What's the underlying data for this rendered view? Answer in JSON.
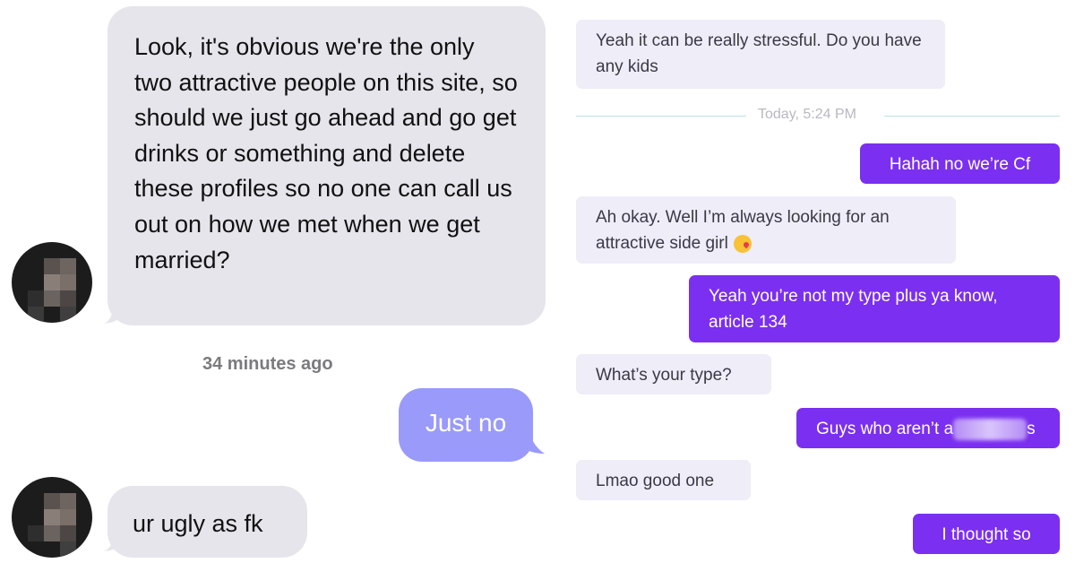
{
  "left_chat": {
    "message_1": "Look, it's obvious we're the only two attractive people on this site, so should we just go ahead and go get drinks or something and delete these profiles so no one can call us out on how we met when we get married?",
    "timestamp": "34 minutes ago",
    "reply_1": "Just no",
    "message_2": "ur ugly as fk"
  },
  "right_chat": {
    "msg_in_1": "Yeah it can be really stressful. Do you have any kids",
    "divider": "Today, 5:24 PM",
    "msg_out_1": "Hahah no we’re Cf",
    "msg_in_2": "Ah okay. Well I’m always looking for an attractive side girl",
    "msg_out_2": "Yeah you’re not my type plus ya know, article 134",
    "msg_in_3": "What’s your type?",
    "msg_out_3_prefix": "Guys who aren’t a",
    "msg_out_3_suffix": "s",
    "msg_in_4": "Lmao good one",
    "msg_out_4": "I thought so"
  },
  "colors": {
    "incoming_grey": "#e6e5eb",
    "outgoing_blue": "#9a9afa",
    "right_incoming": "#eeedf8",
    "right_outgoing": "#7b2ff0"
  },
  "icons": [
    "pixelated-avatar-icon",
    "kiss-emoji-icon"
  ]
}
